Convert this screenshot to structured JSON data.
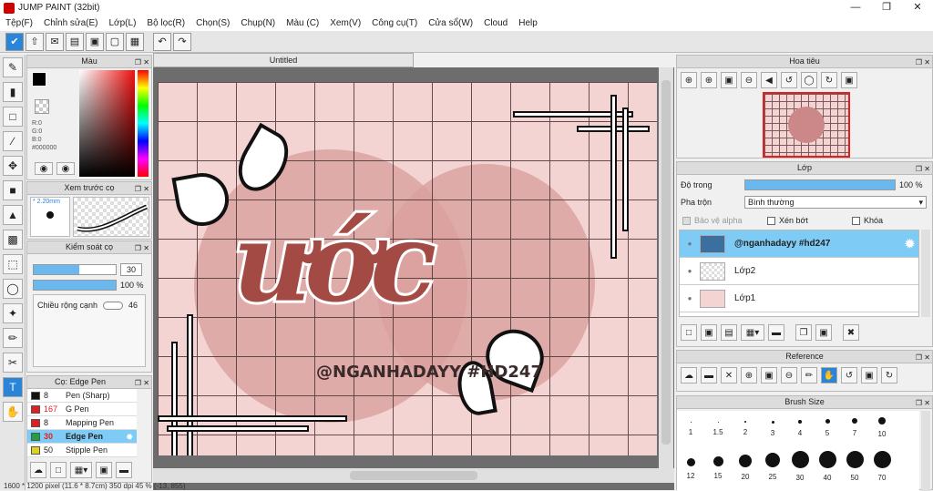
{
  "window": {
    "title": "JUMP PAINT (32bit)"
  },
  "menu": [
    "Tệp(F)",
    "Chỉnh sửa(E)",
    "Lớp(L)",
    "Bộ lọc(R)",
    "Chọn(S)",
    "Chụp(N)",
    "Màu (C)",
    "Xem(V)",
    "Công cụ(T)",
    "Cửa sổ(W)",
    "Cloud",
    "Help"
  ],
  "document": {
    "tab": "Untitled"
  },
  "artwork": {
    "big_text": "ước",
    "handle": "@NGANHADAYY #HD247"
  },
  "color_panel": {
    "title": "Màu",
    "r": "R:0",
    "g": "G:0",
    "b": "B:0",
    "hex": "#000000"
  },
  "preview_panel": {
    "title": "Xem trước cọ",
    "size": "2.20mm"
  },
  "control_panel": {
    "title": "Kiểm soát cọ",
    "size_value": "30",
    "opacity_value": "100 %",
    "edge_label": "Chiều rộng cạnh",
    "edge_value": "46"
  },
  "brush_panel": {
    "title": "Cọ: Edge Pen",
    "brushes": [
      {
        "size": "8",
        "name": "Pen (Sharp)",
        "color": "#111111"
      },
      {
        "size": "167",
        "name": "G Pen",
        "color": "#e02020"
      },
      {
        "size": "8",
        "name": "Mapping Pen",
        "color": "#e02020"
      },
      {
        "size": "30",
        "name": "Edge Pen",
        "color": "#20a040"
      },
      {
        "size": "50",
        "name": "Stipple Pen",
        "color": "#e0d020"
      }
    ]
  },
  "navigator_panel": {
    "title": "Hoa tiêu"
  },
  "layer_panel": {
    "title": "Lớp",
    "opacity_label": "Độ trong",
    "opacity_value": "100 %",
    "blend_label": "Pha trộn",
    "blend_value": "Bình thường",
    "protect_alpha": "Bảo vệ alpha",
    "clipping": "Xén bớt",
    "lock": "Khóa",
    "layers": [
      {
        "name": "@nganhadayy #hd247"
      },
      {
        "name": "Lớp2"
      },
      {
        "name": "Lớp1"
      }
    ]
  },
  "reference_panel": {
    "title": "Reference"
  },
  "brush_size_panel": {
    "title": "Brush Size",
    "row1": [
      "1",
      "1.5",
      "2",
      "3",
      "4",
      "5",
      "7",
      "10"
    ],
    "row2": [
      "12",
      "15",
      "20",
      "25",
      "30",
      "40",
      "50",
      "70"
    ]
  },
  "status": "1600 * 1200 pixel   (11.6 * 8.7cm)   350 dpi   45 %   (-13, 855)"
}
